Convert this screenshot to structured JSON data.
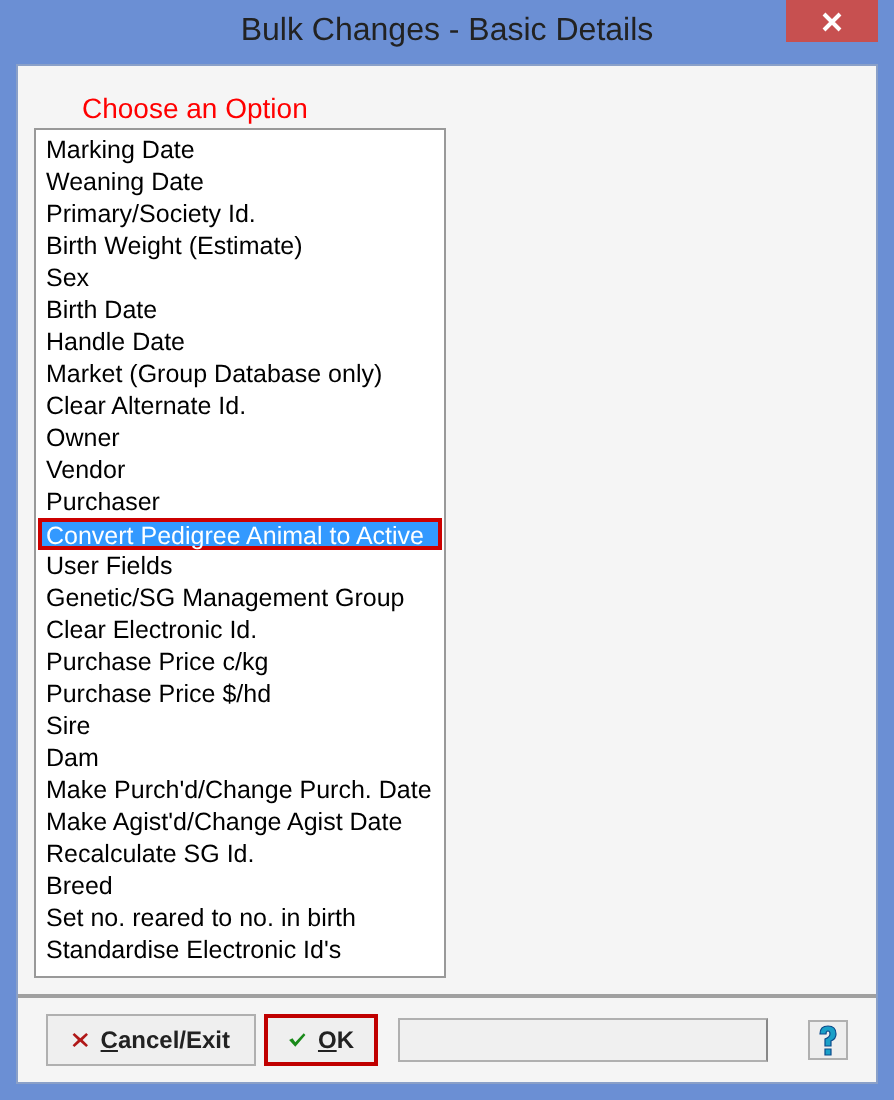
{
  "window": {
    "title": "Bulk Changes - Basic Details"
  },
  "option_list": {
    "heading": "Choose an Option",
    "items": [
      {
        "label": "Marking Date",
        "selected": false
      },
      {
        "label": "Weaning Date",
        "selected": false
      },
      {
        "label": "Primary/Society Id.",
        "selected": false
      },
      {
        "label": "Birth Weight (Estimate)",
        "selected": false
      },
      {
        "label": "Sex",
        "selected": false
      },
      {
        "label": "Birth Date",
        "selected": false
      },
      {
        "label": "Handle Date",
        "selected": false
      },
      {
        "label": "Market (Group Database only)",
        "selected": false
      },
      {
        "label": "Clear Alternate Id.",
        "selected": false
      },
      {
        "label": "Owner",
        "selected": false
      },
      {
        "label": "Vendor",
        "selected": false
      },
      {
        "label": "Purchaser",
        "selected": false
      },
      {
        "label": "Convert Pedigree Animal to Active",
        "selected": true
      },
      {
        "label": "User Fields",
        "selected": false
      },
      {
        "label": "Genetic/SG Management Group",
        "selected": false
      },
      {
        "label": "Clear Electronic Id.",
        "selected": false
      },
      {
        "label": "Purchase Price c/kg",
        "selected": false
      },
      {
        "label": "Purchase Price $/hd",
        "selected": false
      },
      {
        "label": "Sire",
        "selected": false
      },
      {
        "label": "Dam",
        "selected": false
      },
      {
        "label": "Make Purch'd/Change Purch. Date",
        "selected": false
      },
      {
        "label": "Make Agist'd/Change Agist Date",
        "selected": false
      },
      {
        "label": "Recalculate SG Id.",
        "selected": false
      },
      {
        "label": "Breed",
        "selected": false
      },
      {
        "label": "Set no. reared to no. in birth",
        "selected": false
      },
      {
        "label": "Standardise Electronic Id's",
        "selected": false
      }
    ]
  },
  "buttons": [
    {
      "kind": "cancel",
      "accelerator": "C",
      "rest": "ancel/Exit",
      "focused": false
    },
    {
      "kind": "ok",
      "accelerator": "O",
      "rest": "K",
      "focused": true
    }
  ]
}
